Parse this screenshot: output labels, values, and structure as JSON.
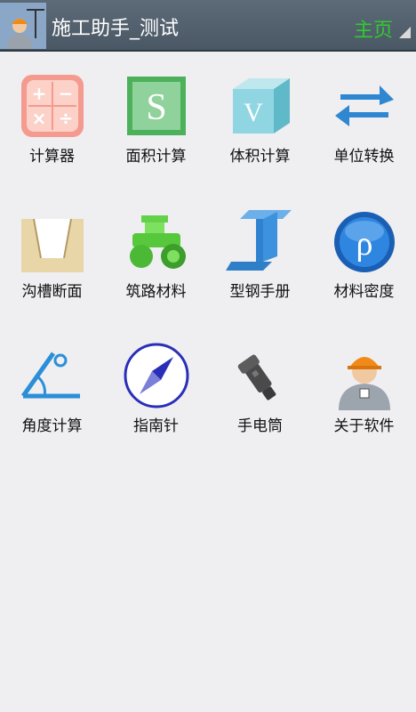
{
  "header": {
    "title": "施工助手_测试",
    "home_label": "主页"
  },
  "grid": {
    "items": [
      {
        "label": "计算器",
        "icon": "calculator-icon"
      },
      {
        "label": "面积计算",
        "icon": "area-s-icon"
      },
      {
        "label": "体积计算",
        "icon": "volume-cube-icon"
      },
      {
        "label": "单位转换",
        "icon": "swap-arrows-icon"
      },
      {
        "label": "沟槽断面",
        "icon": "trench-icon"
      },
      {
        "label": "筑路材料",
        "icon": "road-roller-icon"
      },
      {
        "label": "型钢手册",
        "icon": "i-beam-icon"
      },
      {
        "label": "材料密度",
        "icon": "rho-icon"
      },
      {
        "label": "角度计算",
        "icon": "angle-icon"
      },
      {
        "label": "指南针",
        "icon": "compass-icon"
      },
      {
        "label": "手电筒",
        "icon": "flashlight-icon"
      },
      {
        "label": "关于软件",
        "icon": "worker-avatar-icon"
      }
    ]
  },
  "icon_texts": {
    "area_letter": "S",
    "volume_letter": "V",
    "rho_letter": "ρ",
    "calc_plus": "+",
    "calc_minus": "−",
    "calc_times": "×",
    "calc_divide": "÷"
  }
}
